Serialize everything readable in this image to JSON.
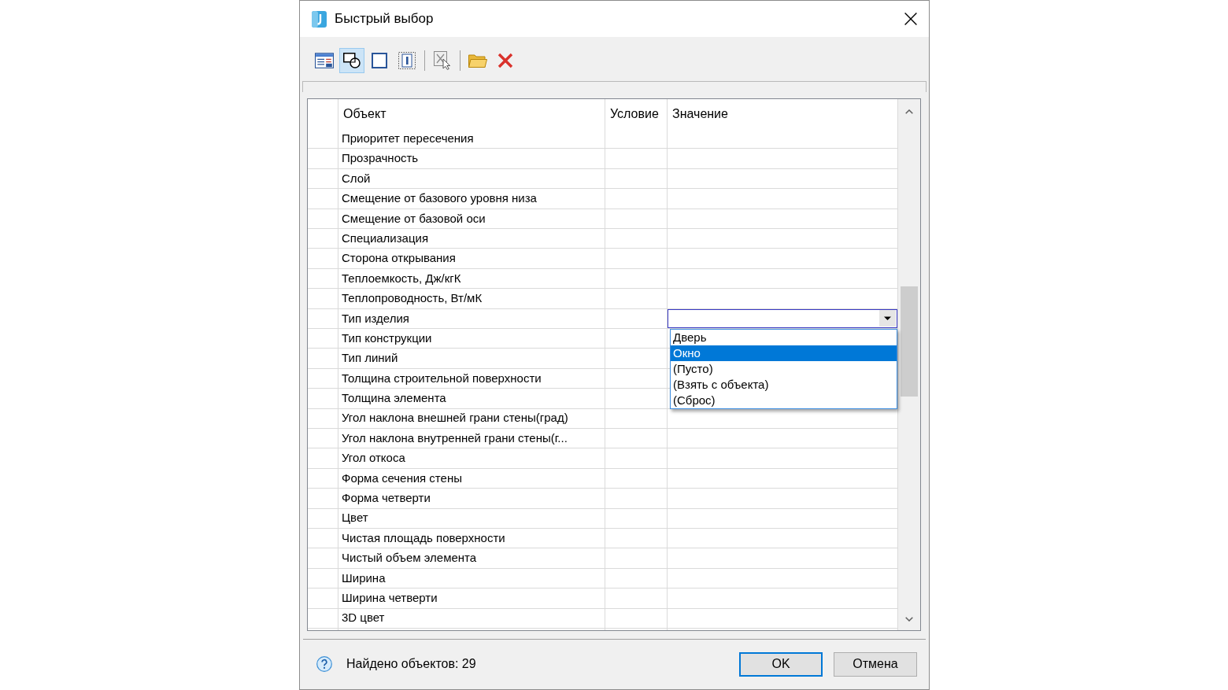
{
  "window": {
    "title": "Быстрый выбор"
  },
  "toolbar": [
    {
      "kind": "button",
      "selected": false
    },
    {
      "kind": "button",
      "selected": true
    },
    {
      "kind": "button",
      "selected": false
    },
    {
      "kind": "button",
      "selected": false
    },
    {
      "kind": "separator"
    },
    {
      "kind": "button",
      "selected": false
    },
    {
      "kind": "separator"
    },
    {
      "kind": "button",
      "selected": false
    },
    {
      "kind": "button",
      "selected": false
    }
  ],
  "table": {
    "columns": [
      "Объект",
      "Условие",
      "Значение"
    ],
    "rows": [
      {
        "object": "Приоритет пересечения"
      },
      {
        "object": "Прозрачность"
      },
      {
        "object": "Слой"
      },
      {
        "object": "Смещение от базового уровня низа"
      },
      {
        "object": "Смещение от базовой оси"
      },
      {
        "object": "Специализация"
      },
      {
        "object": "Сторона открывания"
      },
      {
        "object": "Теплоемкость, Дж/кгК"
      },
      {
        "object": "Теплопроводность, Вт/мК"
      },
      {
        "object": "Тип изделия",
        "value_editor": {
          "expanded": true,
          "options": [
            {
              "label": "Дверь",
              "selected": false
            },
            {
              "label": "Окно",
              "selected": true
            },
            {
              "label": "(Пусто)",
              "selected": false
            },
            {
              "label": "(Взять с объекта)",
              "selected": false
            },
            {
              "label": "(Сброс)",
              "selected": false
            }
          ]
        }
      },
      {
        "object": "Тип конструкции"
      },
      {
        "object": "Тип линий"
      },
      {
        "object": "Толщина строительной поверхности"
      },
      {
        "object": "Толщина элемента"
      },
      {
        "object": "Угол наклона внешней грани стены(град)"
      },
      {
        "object": "Угол наклона внутренней грани стены(г..."
      },
      {
        "object": "Угол откоса"
      },
      {
        "object": "Форма сечения стены"
      },
      {
        "object": "Форма четверти"
      },
      {
        "object": "Цвет"
      },
      {
        "object": "Чистая площадь поверхности"
      },
      {
        "object": "Чистый объем элемента"
      },
      {
        "object": "Ширина"
      },
      {
        "object": "Ширина четверти"
      },
      {
        "object": "3D цвет"
      }
    ]
  },
  "status_bar": {
    "text": "Найдено объектов: 29"
  },
  "buttons": [
    {
      "label": "OK",
      "default": true
    },
    {
      "label": "Отмена",
      "default": false
    }
  ]
}
